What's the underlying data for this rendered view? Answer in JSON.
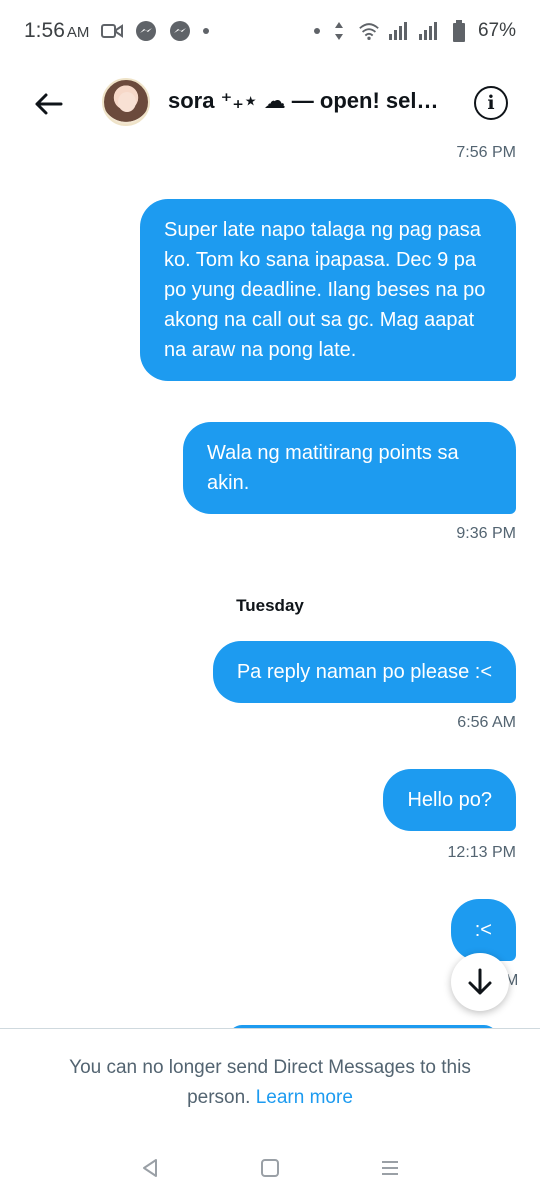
{
  "status_bar": {
    "time": "1:56",
    "ampm": "AM",
    "battery_text": "67%"
  },
  "header": {
    "title": "sora ⁺₊⋆ ☁ — open! sel…"
  },
  "messages": [
    {
      "time": "7:56 PM"
    },
    {
      "text": "Super late napo talaga ng pag pasa ko. Tom ko sana ipapasa. Dec 9 pa po yung deadline. Ilang beses na po akong na call out sa gc. Mag aapat na araw na pong late."
    },
    {
      "text": "Wala ng matitirang points sa akin.",
      "time": "9:36 PM"
    },
    {
      "day": "Tuesday"
    },
    {
      "text": "Pa reply naman po please :<",
      "time": "6:56 AM"
    },
    {
      "text": "Hello po?",
      "time": "12:13 PM"
    },
    {
      "text": ":<",
      "time_partial": "M"
    }
  ],
  "footer": {
    "notice": "You can no longer send Direct Messages to this person.",
    "link": "Learn more"
  },
  "colors": {
    "accent": "#1d9bf0",
    "text": "#0f1419",
    "secondary": "#536471"
  }
}
